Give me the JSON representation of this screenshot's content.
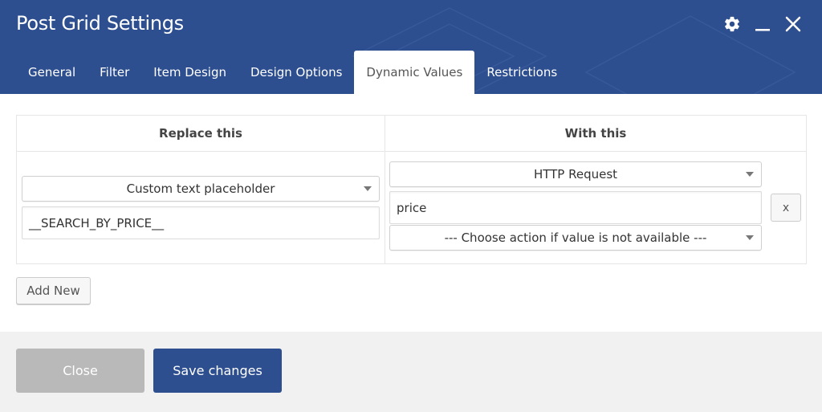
{
  "dialog": {
    "title": "Post Grid Settings",
    "controls": {
      "settings_icon": "gear-icon",
      "minimize_icon": "minimize-icon",
      "close_icon": "close-icon"
    }
  },
  "tabs": [
    {
      "label": "General",
      "active": false
    },
    {
      "label": "Filter",
      "active": false
    },
    {
      "label": "Item Design",
      "active": false
    },
    {
      "label": "Design Options",
      "active": false
    },
    {
      "label": "Dynamic Values",
      "active": true
    },
    {
      "label": "Restrictions",
      "active": false
    }
  ],
  "table": {
    "headers": {
      "replace": "Replace this",
      "with": "With this"
    },
    "rows": [
      {
        "replace_type": "Custom text placeholder",
        "replace_value": "__SEARCH_BY_PRICE__",
        "with_source": "HTTP Request",
        "with_value": "price",
        "fallback_action": "--- Choose action if value is not available ---",
        "remove_label": "x"
      }
    ]
  },
  "add_new_label": "Add New",
  "footer": {
    "close_label": "Close",
    "save_label": "Save changes"
  },
  "colors": {
    "header_bg": "#2d4e8f",
    "save_button": "#2d4e8f",
    "close_button_disabled": "#b9b9b9",
    "footer_bg": "#f1f1f1"
  }
}
